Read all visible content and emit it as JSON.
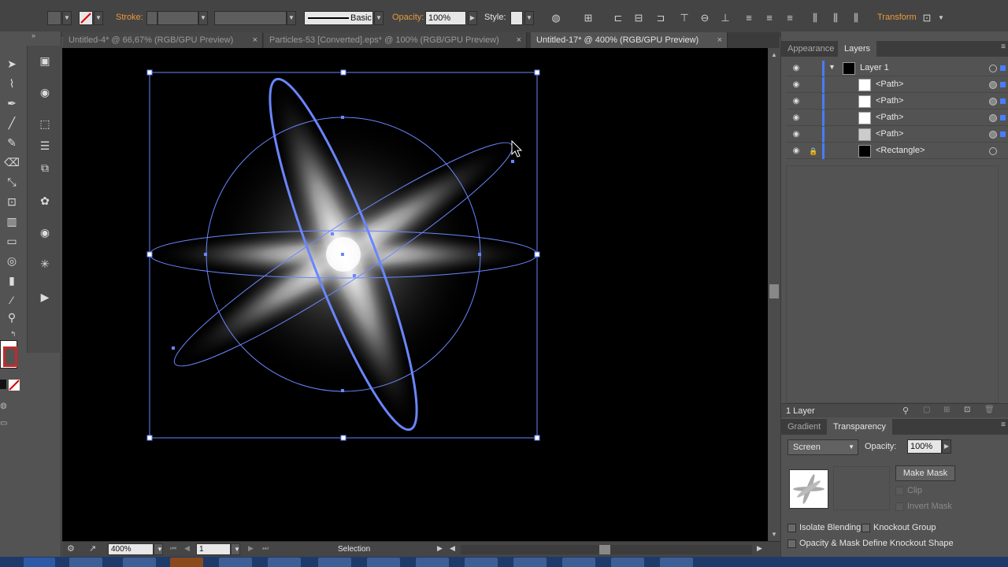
{
  "control_bar": {
    "stroke_label": "Stroke:",
    "brush": "Basic",
    "opacity_label": "Opacity:",
    "opacity_value": "100%",
    "style_label": "Style:",
    "transform_label": "Transform"
  },
  "tabs": [
    {
      "label": "Untitled-4* @ 66,67% (RGB/GPU Preview)",
      "close": "×"
    },
    {
      "label": "Particles-53 [Converted].eps* @ 100% (RGB/GPU Preview)",
      "close": "×"
    },
    {
      "label": "Untitled-17* @ 400% (RGB/GPU Preview)",
      "close": "×"
    }
  ],
  "status": {
    "zoom": "400%",
    "artboard": "1",
    "tool": "Selection"
  },
  "layers_panel": {
    "tabs": [
      "Appearance",
      "Layers"
    ],
    "rows": [
      {
        "name": "Layer 1"
      },
      {
        "name": "<Path>"
      },
      {
        "name": "<Path>"
      },
      {
        "name": "<Path>"
      },
      {
        "name": "<Path>"
      },
      {
        "name": "<Rectangle>"
      }
    ],
    "footer": "1 Layer"
  },
  "transparency_panel": {
    "tabs": [
      "Gradient",
      "Transparency"
    ],
    "blend_mode": "Screen",
    "opacity_label": "Opacity:",
    "opacity_value": "100%",
    "make_mask": "Make Mask",
    "clip": "Clip",
    "invert_mask": "Invert Mask",
    "isolate_blending": "Isolate Blending",
    "knockout_group": "Knockout Group",
    "opacity_mask": "Opacity & Mask Define Knockout Shape"
  },
  "colors": {
    "selection": "#6a86ff",
    "accent_orange": "#e89a3c",
    "layer_color": "#4a7cff"
  }
}
